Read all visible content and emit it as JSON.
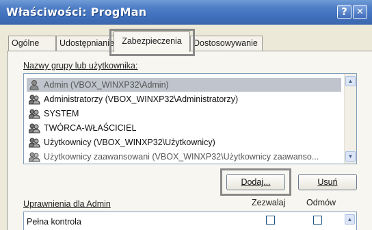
{
  "window": {
    "title": "Właściwości: ProgMan",
    "help_button": "?",
    "close_button": "✕"
  },
  "tabs": [
    {
      "label": "Ogólne"
    },
    {
      "label": "Udostępnianie"
    },
    {
      "label": "Zabezpieczenia",
      "active": true
    },
    {
      "label": "Dostosowywanie"
    }
  ],
  "users": {
    "label": "Nazwy grupy lub użytkownika:",
    "items": [
      {
        "name": "Admin (VBOX_WINXP32\\Admin)",
        "icon": "user-icon",
        "selected": true
      },
      {
        "name": "Administratorzy (VBOX_WINXP32\\Administratorzy)",
        "icon": "group-icon"
      },
      {
        "name": "SYSTEM",
        "icon": "group-icon"
      },
      {
        "name": "TWÓRCA-WŁAŚCICIEL",
        "icon": "group-icon"
      },
      {
        "name": "Użytkownicy (VBOX_WINXP32\\Użytkownicy)",
        "icon": "group-icon"
      },
      {
        "name": "Użytkownicy zaawansowani (VBOX_WINXP32\\Użytkownicy zaawanso...",
        "icon": "group-icon"
      }
    ],
    "add_button": "Dodaj...",
    "remove_button": "Usuń"
  },
  "permissions": {
    "label": "Uprawnienia dla Admin",
    "col_allow": "Zezwalaj",
    "col_deny": "Odmów",
    "rows": [
      {
        "name": "Pełna kontrola",
        "allow": false,
        "deny": false
      }
    ]
  },
  "colors": {
    "titlebar": "#3f6fbb",
    "selection": "#c0c4cc",
    "highlight_frame": "#8a8a8a"
  }
}
